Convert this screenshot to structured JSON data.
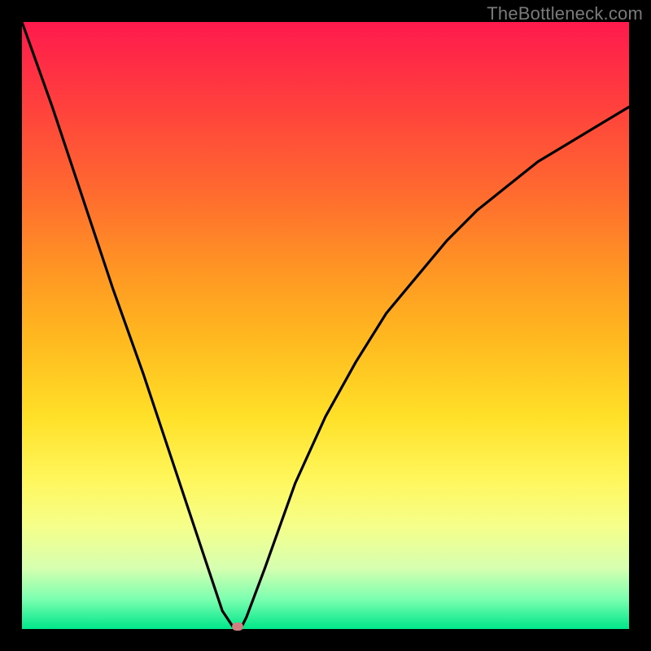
{
  "watermark": "TheBottleneck.com",
  "colors": {
    "frame": "#000000",
    "curve": "#000000",
    "marker": "#d08080",
    "gradient_stops": [
      "#ff1a4d",
      "#ff3b3f",
      "#ff6a2f",
      "#ff9324",
      "#ffb81f",
      "#ffe028",
      "#fff65a",
      "#f6ff8a",
      "#d6ffb0",
      "#7dffb0",
      "#00e68a"
    ]
  },
  "chart_data": {
    "type": "line",
    "title": "",
    "xlabel": "",
    "ylabel": "",
    "xlim": [
      0,
      100
    ],
    "ylim": [
      0,
      100
    ],
    "grid": false,
    "legend": "none",
    "series": [
      {
        "name": "bottleneck-curve",
        "x": [
          0,
          5,
          10,
          15,
          20,
          25,
          30,
          33,
          35,
          36,
          37,
          40,
          45,
          50,
          55,
          60,
          65,
          70,
          75,
          80,
          85,
          90,
          95,
          100
        ],
        "values": [
          100,
          86,
          71,
          56,
          42,
          27,
          12,
          3,
          0,
          0,
          2,
          10,
          24,
          35,
          44,
          52,
          58,
          64,
          69,
          73,
          77,
          80,
          83,
          86
        ]
      }
    ],
    "annotations": [
      {
        "name": "optimal-marker",
        "x": 35.5,
        "y": 0
      }
    ],
    "background": "vertical-gradient red→green (high values = red/top, low values = green/bottom)"
  }
}
